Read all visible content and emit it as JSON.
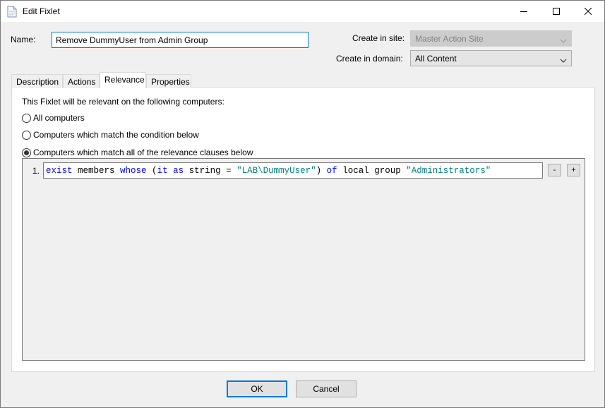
{
  "window": {
    "title": "Edit Fixlet",
    "icon": "document-icon",
    "controls": {
      "minimize": "minimize-icon",
      "maximize": "maximize-icon",
      "close": "close-icon"
    }
  },
  "form": {
    "name_label": "Name:",
    "name_value": "Remove DummyUser from Admin Group",
    "create_in_site_label": "Create in site:",
    "create_in_site_value": "Master Action Site",
    "create_in_domain_label": "Create in domain:",
    "create_in_domain_value": "All Content"
  },
  "tabs": [
    {
      "label": "Description",
      "active": false
    },
    {
      "label": "Actions",
      "active": false
    },
    {
      "label": "Relevance",
      "active": true
    },
    {
      "label": "Properties",
      "active": false
    }
  ],
  "relevance": {
    "intro": "This Fixlet will be relevant on the following computers:",
    "options": [
      {
        "label": "All computers",
        "checked": false
      },
      {
        "label": "Computers which match the condition below",
        "checked": false
      },
      {
        "label": "Computers which match all of the relevance clauses below",
        "checked": true
      }
    ],
    "clauses": [
      {
        "number": "1.",
        "tokens": [
          {
            "text": "exist",
            "kind": "kw"
          },
          {
            "text": " members ",
            "kind": "plain"
          },
          {
            "text": "whose",
            "kind": "kw"
          },
          {
            "text": " (",
            "kind": "plain"
          },
          {
            "text": "it",
            "kind": "kw"
          },
          {
            "text": " ",
            "kind": "plain"
          },
          {
            "text": "as",
            "kind": "kw"
          },
          {
            "text": " string = ",
            "kind": "plain"
          },
          {
            "text": "\"LAB\\DummyUser\"",
            "kind": "str"
          },
          {
            "text": ") ",
            "kind": "plain"
          },
          {
            "text": "of",
            "kind": "kw"
          },
          {
            "text": " local group ",
            "kind": "plain"
          },
          {
            "text": "\"Administrators\"",
            "kind": "str"
          }
        ]
      }
    ],
    "remove_label": "-",
    "add_label": "+"
  },
  "buttons": {
    "ok": "OK",
    "cancel": "Cancel"
  },
  "colors": {
    "keyword": "#0000ff",
    "string": "#008080",
    "focus": "#0078d7"
  }
}
